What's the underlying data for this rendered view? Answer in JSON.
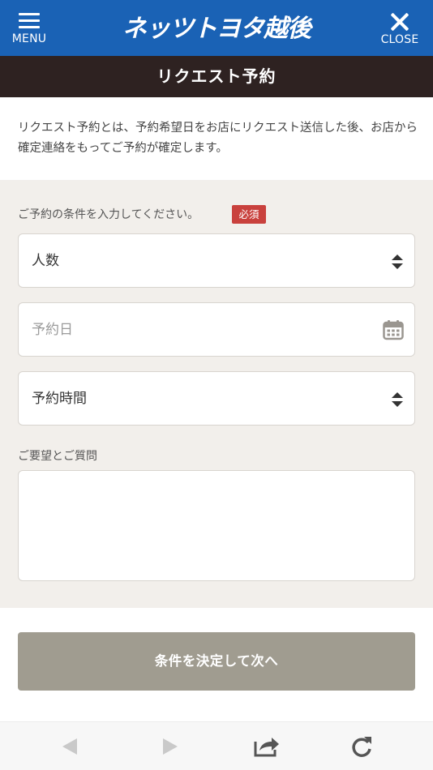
{
  "header": {
    "menu_label": "MENU",
    "logo_text": "ネッツトヨタ越後",
    "close_label": "CLOSE",
    "bar_color": "#1a62b5"
  },
  "page": {
    "title": "リクエスト予約",
    "intro": "リクエスト予約とは、予約希望日をお店にリクエスト送信した後、お店から確定連絡をもってご予約が確定します。"
  },
  "form": {
    "conditions_label": "ご予約の条件を入力してください。",
    "required_badge": "必須",
    "party_size": {
      "value": "人数",
      "icon": "select-updown-icon"
    },
    "date": {
      "placeholder": "予約日",
      "icon": "calendar-icon"
    },
    "time": {
      "value": "予約時間",
      "icon": "select-updown-icon"
    },
    "requests_label": "ご要望とご質問",
    "requests_value": "",
    "submit_label": "条件を決定して次へ"
  },
  "browser_toolbar": {
    "items": [
      "back-icon",
      "forward-icon",
      "share-icon",
      "reload-icon"
    ]
  }
}
